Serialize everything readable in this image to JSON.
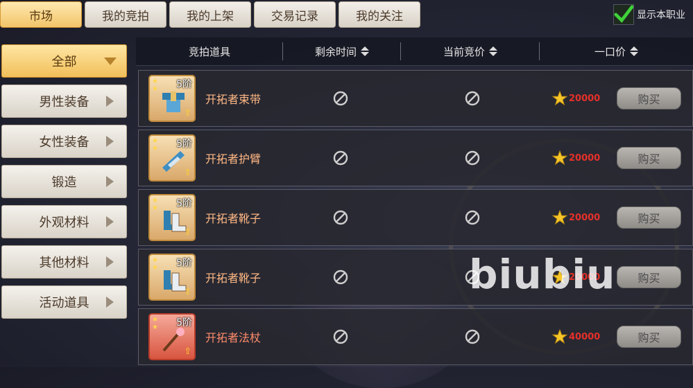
{
  "tabs": [
    {
      "label": "市场",
      "active": true
    },
    {
      "label": "我的竞拍",
      "active": false
    },
    {
      "label": "我的上架",
      "active": false
    },
    {
      "label": "交易记录",
      "active": false
    },
    {
      "label": "我的关注",
      "active": false
    }
  ],
  "show_own_class": {
    "label": "显示本职业",
    "checked": true
  },
  "sidebar": [
    {
      "label": "全部",
      "active": true
    },
    {
      "label": "男性装备",
      "active": false
    },
    {
      "label": "女性装备",
      "active": false
    },
    {
      "label": "锻造",
      "active": false
    },
    {
      "label": "外观材料",
      "active": false
    },
    {
      "label": "其他材料",
      "active": false
    },
    {
      "label": "活动道具",
      "active": false
    }
  ],
  "table_header": {
    "item": "竞拍道具",
    "time_left": "剩余时间",
    "current_bid": "当前竞价",
    "buyout": "一口价"
  },
  "rows": [
    {
      "name": "开拓者束带",
      "grade": "5阶",
      "price": "20000",
      "buy_label": "购买",
      "theme": "gold"
    },
    {
      "name": "开拓者护臂",
      "grade": "5阶",
      "price": "20000",
      "buy_label": "购买",
      "theme": "gold"
    },
    {
      "name": "开拓者靴子",
      "grade": "5阶",
      "price": "20000",
      "buy_label": "购买",
      "theme": "gold"
    },
    {
      "name": "开拓者靴子",
      "grade": "5阶",
      "price": "20000",
      "buy_label": "购买",
      "theme": "gold"
    },
    {
      "name": "开拓者法杖",
      "grade": "5阶",
      "price": "40000",
      "buy_label": "购买",
      "theme": "red"
    }
  ],
  "watermark": "biubiu",
  "colors": {
    "accent": "#f2c46a",
    "price": "#e5302a",
    "item_name": "#ffb884"
  }
}
